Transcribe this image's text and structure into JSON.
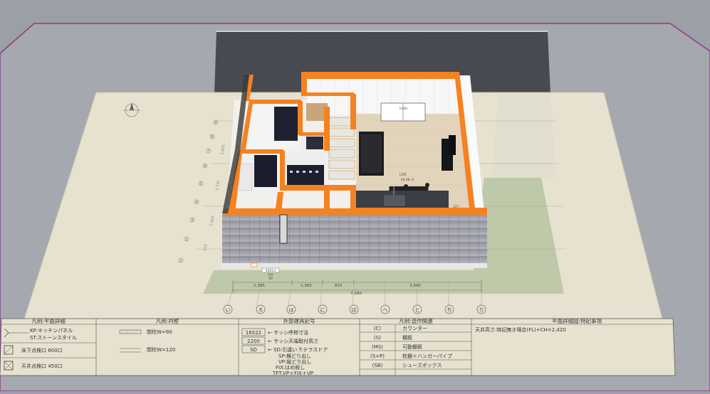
{
  "scene": {
    "plan_labels": {
      "ldk_room": "LDK",
      "ldk_area": "28.98 ㎡",
      "balcony_tag": "3,640",
      "sash_box": "02613",
      "sash_code": "FIX",
      "sash_type": "VP",
      "small_dim": "527"
    },
    "dimensions": {
      "segments": [
        "1,365",
        "1,365",
        "910",
        "3,640"
      ],
      "total": "7,280"
    },
    "grid_axis_letters": [
      "い",
      "ろ",
      "は",
      "に",
      "ほ",
      "へ",
      "と",
      "ち",
      "り"
    ],
    "grid_axis_numbers": [
      "9",
      "8",
      "7",
      "6",
      "5",
      "4",
      "3",
      "2",
      "1"
    ],
    "side_dims": [
      "910",
      "1,820",
      "2,730",
      "1,820"
    ]
  },
  "legend": {
    "plan_detail": {
      "header": "凡例:平面詳細",
      "kp": "KP:キッチンパネル",
      "st": "ST:ストーンスタイル",
      "floor_hatch": "床下点検口 600口",
      "ceiling_hatch": "天井点検口 450口"
    },
    "interior_walls": {
      "header": "凡例:内壁",
      "row1": "間柱W=90",
      "row2": "間柱W=120"
    },
    "exterior_fittings": {
      "header": "外部建具記号",
      "box1": "16522",
      "text1": "← サッシ呼称寸法",
      "box2": "2200",
      "text2": "← サッシ天端取付高さ",
      "box3": "SD",
      "text3": "← SD:引違い  T:テラスドア",
      "text4": "SP:横どり出し",
      "text5": "VP:縦どり出し",
      "text6": "FIX:はめ殺し",
      "text7": "TFT:VP＋FIX＋VP"
    },
    "fixtures": {
      "header": "凡例:造作関連",
      "rows": [
        {
          "code": "(C)",
          "name": "カウンター"
        },
        {
          "code": "(S)",
          "name": "棚板"
        },
        {
          "code": "(MS)",
          "name": "可動棚板"
        },
        {
          "code": "(S+P)",
          "name": "枕棚＋ハンガーパイプ"
        },
        {
          "code": "(SB)",
          "name": "シューズボックス"
        }
      ]
    },
    "notes": {
      "header": "平面詳細図:特記事項",
      "text": "天井高さ:特記無き場合(FL)+CH=2,420"
    }
  },
  "colors": {
    "background": "#9b9fa6",
    "paper": "#e6e2cf",
    "wall_accent": "#f58220",
    "grass": "#b8c6a3",
    "asphalt": "#474a50",
    "magenta_boundary": "#8a3a8a"
  },
  "icons": {
    "compass": "north-arrow-icon"
  }
}
